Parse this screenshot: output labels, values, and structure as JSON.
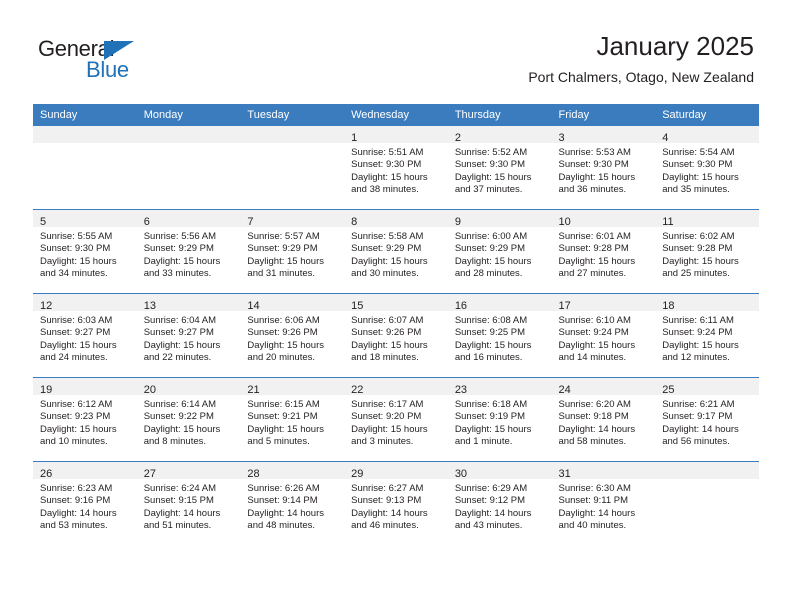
{
  "brand": {
    "logo_text_1": "General",
    "logo_text_2": "Blue",
    "logo_triangle_color": "#1f72b8",
    "logo_blue_color": "#1f72b8"
  },
  "header": {
    "title": "January 2025",
    "subtitle": "Port Chalmers, Otago, New Zealand"
  },
  "theme": {
    "header_row_bg": "#3a7cbe",
    "daynum_band_bg": "#f1f1f1",
    "text_color": "#231f20"
  },
  "calendar": {
    "weekday_headers": [
      "Sunday",
      "Monday",
      "Tuesday",
      "Wednesday",
      "Thursday",
      "Friday",
      "Saturday"
    ],
    "weeks": [
      [
        {
          "empty": true
        },
        {
          "empty": true
        },
        {
          "empty": true
        },
        {
          "day": "1",
          "sunrise": "Sunrise: 5:51 AM",
          "sunset": "Sunset: 9:30 PM",
          "daylight_1": "Daylight: 15 hours",
          "daylight_2": "and 38 minutes."
        },
        {
          "day": "2",
          "sunrise": "Sunrise: 5:52 AM",
          "sunset": "Sunset: 9:30 PM",
          "daylight_1": "Daylight: 15 hours",
          "daylight_2": "and 37 minutes."
        },
        {
          "day": "3",
          "sunrise": "Sunrise: 5:53 AM",
          "sunset": "Sunset: 9:30 PM",
          "daylight_1": "Daylight: 15 hours",
          "daylight_2": "and 36 minutes."
        },
        {
          "day": "4",
          "sunrise": "Sunrise: 5:54 AM",
          "sunset": "Sunset: 9:30 PM",
          "daylight_1": "Daylight: 15 hours",
          "daylight_2": "and 35 minutes."
        }
      ],
      [
        {
          "day": "5",
          "sunrise": "Sunrise: 5:55 AM",
          "sunset": "Sunset: 9:30 PM",
          "daylight_1": "Daylight: 15 hours",
          "daylight_2": "and 34 minutes."
        },
        {
          "day": "6",
          "sunrise": "Sunrise: 5:56 AM",
          "sunset": "Sunset: 9:29 PM",
          "daylight_1": "Daylight: 15 hours",
          "daylight_2": "and 33 minutes."
        },
        {
          "day": "7",
          "sunrise": "Sunrise: 5:57 AM",
          "sunset": "Sunset: 9:29 PM",
          "daylight_1": "Daylight: 15 hours",
          "daylight_2": "and 31 minutes."
        },
        {
          "day": "8",
          "sunrise": "Sunrise: 5:58 AM",
          "sunset": "Sunset: 9:29 PM",
          "daylight_1": "Daylight: 15 hours",
          "daylight_2": "and 30 minutes."
        },
        {
          "day": "9",
          "sunrise": "Sunrise: 6:00 AM",
          "sunset": "Sunset: 9:29 PM",
          "daylight_1": "Daylight: 15 hours",
          "daylight_2": "and 28 minutes."
        },
        {
          "day": "10",
          "sunrise": "Sunrise: 6:01 AM",
          "sunset": "Sunset: 9:28 PM",
          "daylight_1": "Daylight: 15 hours",
          "daylight_2": "and 27 minutes."
        },
        {
          "day": "11",
          "sunrise": "Sunrise: 6:02 AM",
          "sunset": "Sunset: 9:28 PM",
          "daylight_1": "Daylight: 15 hours",
          "daylight_2": "and 25 minutes."
        }
      ],
      [
        {
          "day": "12",
          "sunrise": "Sunrise: 6:03 AM",
          "sunset": "Sunset: 9:27 PM",
          "daylight_1": "Daylight: 15 hours",
          "daylight_2": "and 24 minutes."
        },
        {
          "day": "13",
          "sunrise": "Sunrise: 6:04 AM",
          "sunset": "Sunset: 9:27 PM",
          "daylight_1": "Daylight: 15 hours",
          "daylight_2": "and 22 minutes."
        },
        {
          "day": "14",
          "sunrise": "Sunrise: 6:06 AM",
          "sunset": "Sunset: 9:26 PM",
          "daylight_1": "Daylight: 15 hours",
          "daylight_2": "and 20 minutes."
        },
        {
          "day": "15",
          "sunrise": "Sunrise: 6:07 AM",
          "sunset": "Sunset: 9:26 PM",
          "daylight_1": "Daylight: 15 hours",
          "daylight_2": "and 18 minutes."
        },
        {
          "day": "16",
          "sunrise": "Sunrise: 6:08 AM",
          "sunset": "Sunset: 9:25 PM",
          "daylight_1": "Daylight: 15 hours",
          "daylight_2": "and 16 minutes."
        },
        {
          "day": "17",
          "sunrise": "Sunrise: 6:10 AM",
          "sunset": "Sunset: 9:24 PM",
          "daylight_1": "Daylight: 15 hours",
          "daylight_2": "and 14 minutes."
        },
        {
          "day": "18",
          "sunrise": "Sunrise: 6:11 AM",
          "sunset": "Sunset: 9:24 PM",
          "daylight_1": "Daylight: 15 hours",
          "daylight_2": "and 12 minutes."
        }
      ],
      [
        {
          "day": "19",
          "sunrise": "Sunrise: 6:12 AM",
          "sunset": "Sunset: 9:23 PM",
          "daylight_1": "Daylight: 15 hours",
          "daylight_2": "and 10 minutes."
        },
        {
          "day": "20",
          "sunrise": "Sunrise: 6:14 AM",
          "sunset": "Sunset: 9:22 PM",
          "daylight_1": "Daylight: 15 hours",
          "daylight_2": "and 8 minutes."
        },
        {
          "day": "21",
          "sunrise": "Sunrise: 6:15 AM",
          "sunset": "Sunset: 9:21 PM",
          "daylight_1": "Daylight: 15 hours",
          "daylight_2": "and 5 minutes."
        },
        {
          "day": "22",
          "sunrise": "Sunrise: 6:17 AM",
          "sunset": "Sunset: 9:20 PM",
          "daylight_1": "Daylight: 15 hours",
          "daylight_2": "and 3 minutes."
        },
        {
          "day": "23",
          "sunrise": "Sunrise: 6:18 AM",
          "sunset": "Sunset: 9:19 PM",
          "daylight_1": "Daylight: 15 hours",
          "daylight_2": "and 1 minute."
        },
        {
          "day": "24",
          "sunrise": "Sunrise: 6:20 AM",
          "sunset": "Sunset: 9:18 PM",
          "daylight_1": "Daylight: 14 hours",
          "daylight_2": "and 58 minutes."
        },
        {
          "day": "25",
          "sunrise": "Sunrise: 6:21 AM",
          "sunset": "Sunset: 9:17 PM",
          "daylight_1": "Daylight: 14 hours",
          "daylight_2": "and 56 minutes."
        }
      ],
      [
        {
          "day": "26",
          "sunrise": "Sunrise: 6:23 AM",
          "sunset": "Sunset: 9:16 PM",
          "daylight_1": "Daylight: 14 hours",
          "daylight_2": "and 53 minutes."
        },
        {
          "day": "27",
          "sunrise": "Sunrise: 6:24 AM",
          "sunset": "Sunset: 9:15 PM",
          "daylight_1": "Daylight: 14 hours",
          "daylight_2": "and 51 minutes."
        },
        {
          "day": "28",
          "sunrise": "Sunrise: 6:26 AM",
          "sunset": "Sunset: 9:14 PM",
          "daylight_1": "Daylight: 14 hours",
          "daylight_2": "and 48 minutes."
        },
        {
          "day": "29",
          "sunrise": "Sunrise: 6:27 AM",
          "sunset": "Sunset: 9:13 PM",
          "daylight_1": "Daylight: 14 hours",
          "daylight_2": "and 46 minutes."
        },
        {
          "day": "30",
          "sunrise": "Sunrise: 6:29 AM",
          "sunset": "Sunset: 9:12 PM",
          "daylight_1": "Daylight: 14 hours",
          "daylight_2": "and 43 minutes."
        },
        {
          "day": "31",
          "sunrise": "Sunrise: 6:30 AM",
          "sunset": "Sunset: 9:11 PM",
          "daylight_1": "Daylight: 14 hours",
          "daylight_2": "and 40 minutes."
        },
        {
          "empty": true
        }
      ]
    ]
  }
}
